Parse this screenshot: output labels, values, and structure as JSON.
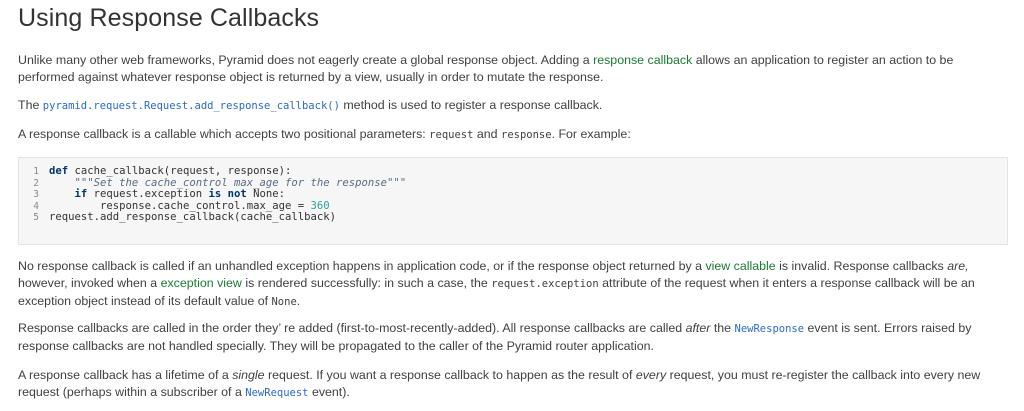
{
  "title": "Using Response Callbacks",
  "p1": {
    "a": "Unlike many other web frameworks, Pyramid does not eagerly create a global response object. Adding a ",
    "link": "response callback",
    "b": " allows an application to register an action to be performed against whatever response object is returned by a view, usually in order to mutate the response."
  },
  "p2": {
    "a": "The ",
    "code": "pyramid.request.Request.add_response_callback()",
    "b": " method is used to register a response callback."
  },
  "p3": {
    "a": "A response callback is a callable which accepts two positional parameters: ",
    "code1": "request",
    "mid": " and ",
    "code2": "response",
    "b": ". For example:"
  },
  "code": {
    "line_numbers": [
      "1",
      "2",
      "3",
      "4",
      "5"
    ],
    "l1_kw": "def",
    "l1_rest": " cache_callback(request, response):",
    "l2_str": "\"\"\"Set the cache_control max_age for the response\"\"\"",
    "l3_kw1": "if",
    "l3_mid": " request.exception ",
    "l3_kw2": "is not",
    "l3_end": " None:",
    "l4_rest": "response.cache_control.max_age = ",
    "l4_num": "360",
    "l5": "request.add_response_callback(cache_callback)"
  },
  "p4": {
    "a": "No response callback is called if an unhandled exception happens in application code, or if the response object returned by a ",
    "link1": "view callable",
    "b": " is invalid. Response callbacks ",
    "em1": "are,",
    "c": " however, invoked when a ",
    "link2": "exception view",
    "d": " is rendered successfully: in such a case, the ",
    "code1": "request.exception",
    "e": " attribute of the request when it enters a response callback will be an exception object instead of its default value of ",
    "code2": "None",
    "f": "."
  },
  "p5": {
    "a": "Response callbacks are called in the order they’ re added (first-to-most-recently-added). All response callbacks are called ",
    "em1": "after",
    "b": " the ",
    "code1": "NewResponse",
    "c": " event is sent. Errors raised by response callbacks are not handled specially. They will be propagated to the caller of the Pyramid router application."
  },
  "p6": {
    "a": "A response callback has a lifetime of a ",
    "em1": "single",
    "b": " request. If you want a response callback to happen as the result of ",
    "em2": "every",
    "c": " request, you must re-register the callback into every new request (perhaps within a subscriber of a ",
    "code1": "NewRequest",
    "d": " event)."
  },
  "colors": {
    "link": "#1b7a32",
    "code_link": "#2a6ac7",
    "code_bg": "#f6f6f6"
  }
}
